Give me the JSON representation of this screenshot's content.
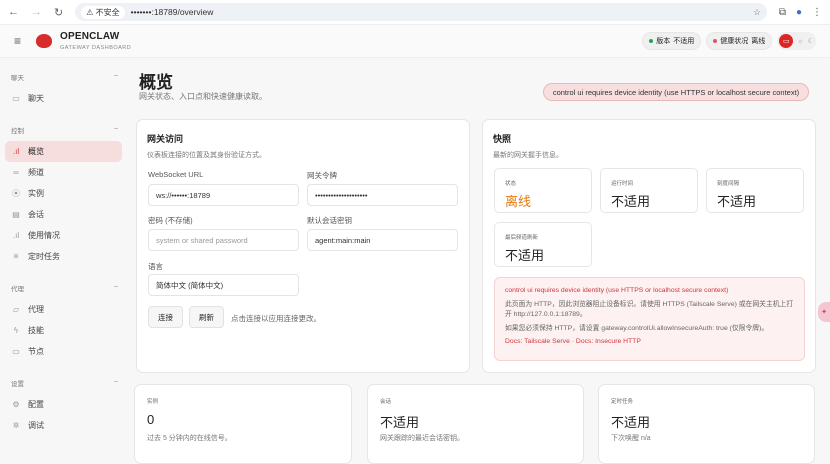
{
  "browser": {
    "security": "不安全",
    "url": "•••••••:18789/overview"
  },
  "header": {
    "brand": "OPENCLAW",
    "subtitle": "GATEWAY DASHBOARD",
    "version_label": "版本",
    "version_value": "不适用",
    "health_label": "健康状况",
    "health_value": "离线",
    "colors": {
      "ok": "#22a35a",
      "bad": "#e0546b",
      "accent": "#dc2626"
    }
  },
  "sidebar": {
    "groups": [
      {
        "label": "聊天",
        "items": [
          {
            "label": "聊天",
            "icon": "message-icon"
          }
        ]
      },
      {
        "label": "控制",
        "items": [
          {
            "label": "概览",
            "icon": "bar-chart-icon",
            "active": true
          },
          {
            "label": "频道",
            "icon": "link-icon"
          },
          {
            "label": "实例",
            "icon": "radio-icon"
          },
          {
            "label": "会话",
            "icon": "file-icon"
          },
          {
            "label": "使用情况",
            "icon": "bar-chart-icon"
          },
          {
            "label": "定时任务",
            "icon": "loader-icon"
          }
        ]
      },
      {
        "label": "代理",
        "items": [
          {
            "label": "代理",
            "icon": "folder-icon"
          },
          {
            "label": "技能",
            "icon": "zap-icon"
          },
          {
            "label": "节点",
            "icon": "monitor-icon"
          }
        ]
      },
      {
        "label": "设置",
        "items": [
          {
            "label": "配置",
            "icon": "gear-icon"
          },
          {
            "label": "调试",
            "icon": "bug-icon"
          }
        ]
      }
    ]
  },
  "page": {
    "title": "概览",
    "subtitle": "网关状态、入口点和快速健康读取。",
    "error_pill": "control ui requires device identity (use HTTPS or localhost secure context)"
  },
  "access": {
    "title": "网关访问",
    "subtitle": "仪表板连接的位置及其身份验证方式。",
    "ws_label": "WebSocket URL",
    "ws_value": "ws://••••••:18789",
    "token_label": "网关令牌",
    "token_value": "••••••••••••••••••••",
    "pw_label": "密码 (不存储)",
    "pw_placeholder": "system or shared password",
    "session_label": "默认会话密钥",
    "session_value": "agent:main:main",
    "lang_label": "语言",
    "lang_value": "简体中文 (简体中文)",
    "connect": "连接",
    "refresh": "刷新",
    "hint": "点击连接以应用连接更改。"
  },
  "snapshot": {
    "title": "快照",
    "subtitle": "最新的网关握手信息。",
    "stats": [
      {
        "label": "状态",
        "value": "离线"
      },
      {
        "label": "运行时间",
        "value": "不适用"
      },
      {
        "label": "刻度间隔",
        "value": "不适用"
      },
      {
        "label": "最后频道刷新",
        "value": "不适用"
      }
    ],
    "alert": {
      "title": "control ui requires device identity (use HTTPS or localhost secure context)",
      "p1": "此页面为 HTTP，因此浏览器阻止设备标识。请使用 HTTPS (Tailscale Serve) 或在网关主机上打开 http://127.0.0.1:18789。",
      "p2": "如果您必须保持 HTTP，请设置 gateway.controlUi.allowInsecureAuth: true (仅限令牌)。",
      "doc1": "Docs: Tailscale Serve",
      "sep": " · ",
      "doc2": "Docs: Insecure HTTP"
    }
  },
  "bottom": [
    {
      "label": "实例",
      "value": "0",
      "sub": "过去 5 分钟内的在线信号。"
    },
    {
      "label": "会话",
      "value": "不适用",
      "sub": "网关跟踪的最近会话密钥。"
    },
    {
      "label": "定时任务",
      "value": "不适用",
      "sub": "下次唤醒 n/a"
    }
  ]
}
